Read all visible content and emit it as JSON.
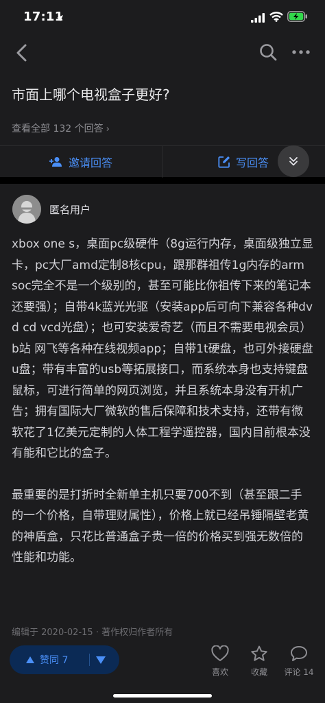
{
  "status_bar": {
    "time": "17:11",
    "icons": [
      "location-arrow-icon",
      "signal-icon",
      "wifi-icon",
      "battery-charging-icon"
    ]
  },
  "nav": {
    "back_icon": "back-arrow-icon",
    "search_icon": "search-icon",
    "more_icon": "more-icon"
  },
  "question": {
    "title": "市面上哪个电视盒子更好?",
    "view_all": "查看全部 132 个回答",
    "view_all_chevron": "›"
  },
  "actions": {
    "invite": "邀请回答",
    "write": "写回答"
  },
  "answer": {
    "author": "匿名用户",
    "paragraphs": [
      "xbox one s，桌面pc级硬件（8g运行内存，桌面级独立显卡，pc大厂amd定制8核cpu，跟那群祖传1g内存的arm soc完全不是一个级别的，甚至可能比你祖传下来的笔记本还要强）；自带4k蓝光光驱（安装app后可向下兼容各种dvd cd vcd光盘）；也可安装爱奇艺（而且不需要电视会员） b站 网飞等各种在线视频app；自带1t硬盘，也可外接硬盘u盘；带有丰富的usb等拓展接口，而系统本身也支持键盘鼠标，可进行简单的网页浏览，并且系统本身没有开机广告；拥有国际大厂微软的售后保障和技术支持，还带有微软花了1亿美元定制的人体工程学遥控器，国内目前根本没有能和它比的盒子。",
      "最重要的是打折时全新单主机只要700不到（甚至跟二手的一个价格，自带理财属性），价格上就已经吊锤隔壁老黄的神盾盒，只花比普通盒子贵一倍的价格买到强无数倍的性能和功能。"
    ],
    "meta": "编辑于 2020-02-15 · 著作权归作者所有"
  },
  "bottom_bar": {
    "upvote_label": "赞同 7",
    "like_label": "喜欢",
    "favorite_label": "收藏",
    "comment_label": "评论 14"
  },
  "colors": {
    "background": "#000000",
    "panel": "#1c1c1e",
    "accent": "#4a8ff7",
    "vote_bg": "#0b2a55",
    "muted": "#8e8e93"
  }
}
